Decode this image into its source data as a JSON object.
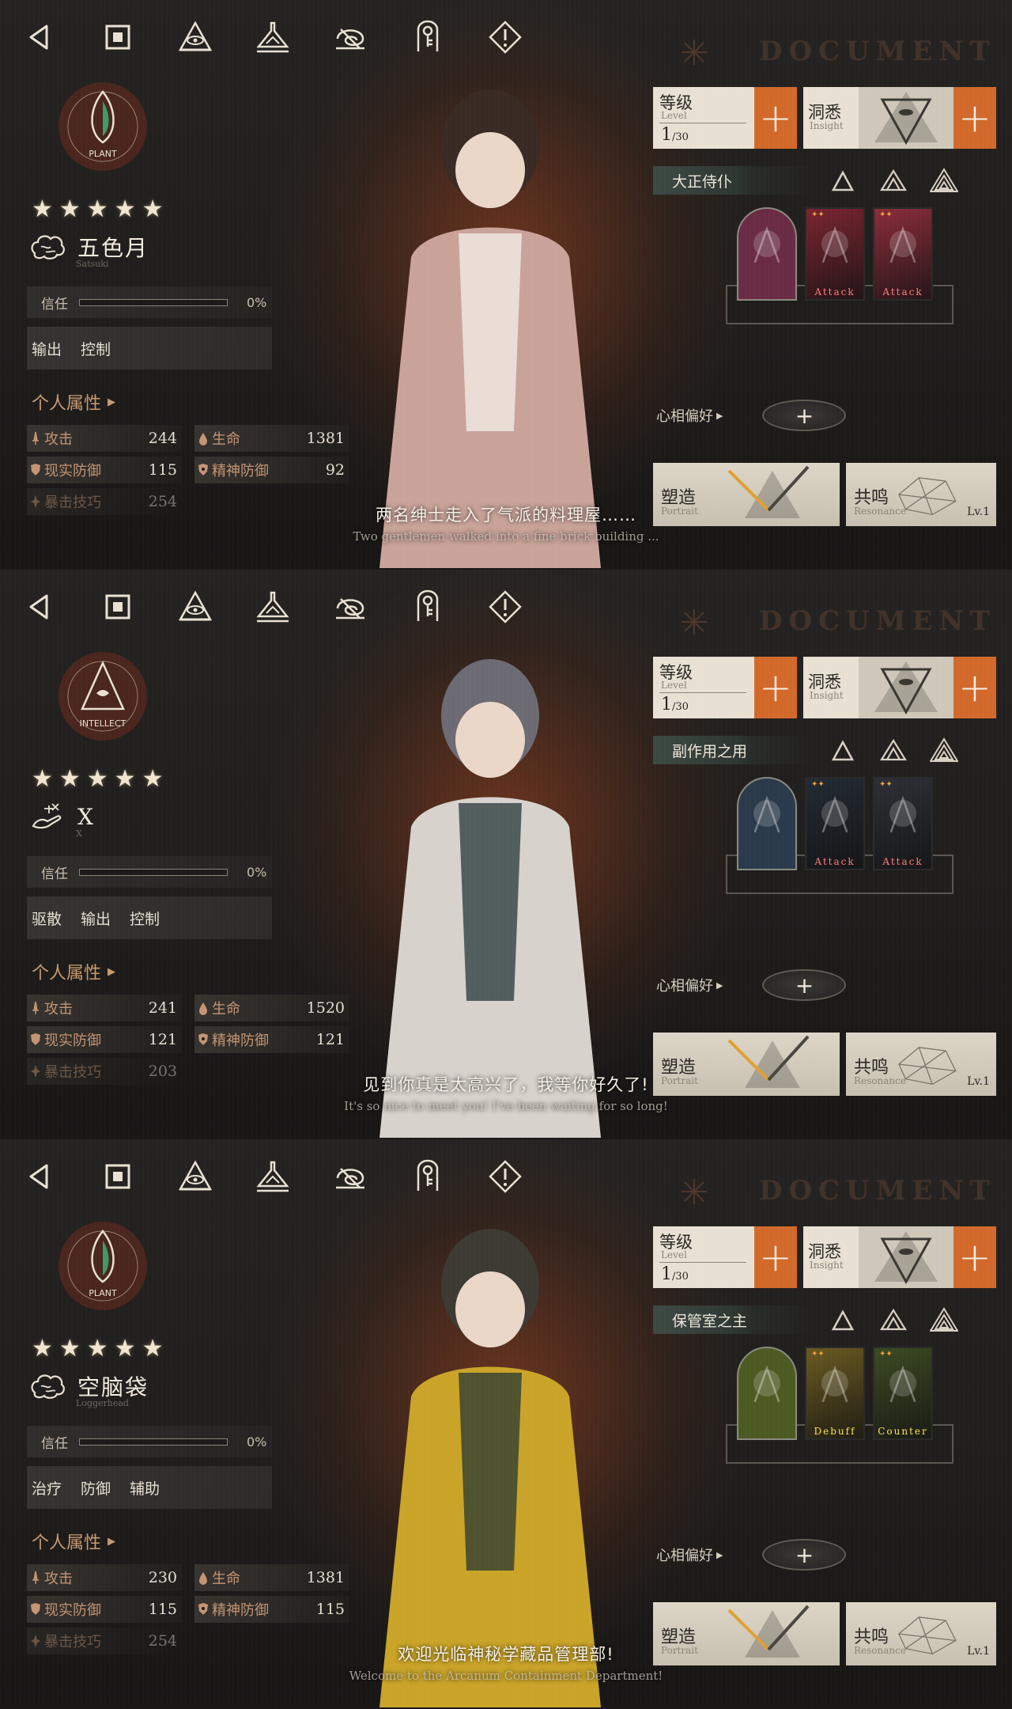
{
  "nav_icons": [
    "back-icon",
    "home-icon",
    "eye-triangle-icon",
    "flask-icon",
    "spiral-icon",
    "key-icon",
    "warning-icon"
  ],
  "watermark": "DOCUMENT",
  "labels": {
    "trust": "信任",
    "attributes": "个人属性",
    "atk": "攻击",
    "hp": "生命",
    "reality_def": "现实防御",
    "mental_def": "精神防御",
    "crit": "暴击技巧",
    "level_title": "等级",
    "level_sub": "Level",
    "insight_title": "洞悉",
    "insight_sub": "Insight",
    "psychube": "心相偏好",
    "portrait_title": "塑造",
    "portrait_sub": "Portrait",
    "resonance_title": "共鸣",
    "resonance_sub": "Resonance",
    "resonance_lv": "Lv.1"
  },
  "colors": {
    "accent_orange": "#d2692a",
    "attr_label": "#c49473",
    "card_red": "#ff7b7b",
    "card_yellow": "#ffe35a"
  },
  "characters": [
    {
      "afflatus": "PLANT",
      "afflatus_icon": "plant-leaf-icon",
      "damage_icon": "brain-mental-icon",
      "stars": "★★★★★",
      "name": "五色月",
      "name_en": "Satsuki",
      "trust_value": "0%",
      "trust_fraction": 0,
      "tags": [
        "输出",
        "控制"
      ],
      "atk": "244",
      "hp": "1381",
      "reality_def": "115",
      "mental_def": "92",
      "crit": "254",
      "level_value": "1",
      "level_max": "/30",
      "title": "大正侍仆",
      "card_labels": [
        "",
        "Attack",
        "Attack"
      ],
      "dialogue_cn": "两名绅士走入了气派的料理屋……",
      "dialogue_en": "Two gentlemen walked into a fine brick building ..."
    },
    {
      "afflatus": "INTELLECT",
      "afflatus_icon": "intellect-eye-icon",
      "damage_icon": "hand-reality-icon",
      "stars": "★★★★★",
      "name": "X",
      "name_en": "X",
      "trust_value": "0%",
      "trust_fraction": 0,
      "tags": [
        "驱散",
        "输出",
        "控制"
      ],
      "atk": "241",
      "hp": "1520",
      "reality_def": "121",
      "mental_def": "121",
      "crit": "203",
      "level_value": "1",
      "level_max": "/30",
      "title": "副作用之用",
      "card_labels": [
        "",
        "Attack",
        "Attack"
      ],
      "dialogue_cn": "见到你真是太高兴了，我等你好久了!",
      "dialogue_en": "It's so nice to meet you! I've been waiting for so long!"
    },
    {
      "afflatus": "PLANT",
      "afflatus_icon": "plant-leaf-icon",
      "damage_icon": "brain-mental-icon",
      "stars": "★★★★★",
      "name": "空脑袋",
      "name_en": "Loggerhead",
      "trust_value": "0%",
      "trust_fraction": 0,
      "tags": [
        "治疗",
        "防御",
        "辅助"
      ],
      "atk": "230",
      "hp": "1381",
      "reality_def": "115",
      "mental_def": "115",
      "crit": "254",
      "level_value": "1",
      "level_max": "/30",
      "title": "保管室之主",
      "card_labels": [
        "",
        "Debuff",
        "Counter"
      ],
      "dialogue_cn": "欢迎光临神秘学藏品管理部!",
      "dialogue_en": "Welcome to the Arcanum Containment Department!"
    }
  ]
}
